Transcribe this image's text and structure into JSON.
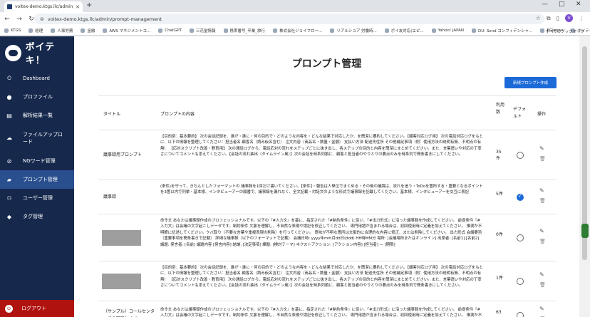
{
  "browser": {
    "tab_title": "voitex-demo.ktgs.llc/admin/pro",
    "url": "voitex-demo.ktgs.llc/admin/prompt-management",
    "bookmarks": [
      "KTGS",
      "経理",
      "人事労務",
      "金融",
      "AWS マネジメントコ...",
      "ChatGPT",
      "三花堂情報",
      "携帯番号_卒業_旅行",
      "株式会社ジョイフロー...",
      "リアルショア 労働時...",
      "ボイ友対応(エピ...",
      "Yahoo! JAPAN",
      "DU: Send コンフィデンシャ...",
      "EGJapan",
      "ボイテキ！"
    ],
    "all_bookmarks": "すべてのブックマーク",
    "avatar_letter": "V"
  },
  "sidebar": {
    "brand": "ボイテキ！",
    "items": [
      {
        "label": "Dashboard",
        "icon": "dashboard-icon"
      },
      {
        "label": "プロファイル",
        "icon": "person-icon"
      },
      {
        "label": "解析結果一覧",
        "icon": "list-icon"
      },
      {
        "label": "ファイルアップロード",
        "icon": "upload-icon"
      },
      {
        "label": "NGワード管理",
        "icon": "block-icon"
      },
      {
        "label": "プロンプト管理",
        "icon": "chat-icon"
      },
      {
        "label": "ユーザー管理",
        "icon": "group-icon"
      },
      {
        "label": "タグ管理",
        "icon": "tag-icon"
      }
    ],
    "logout": "ログアウト"
  },
  "main": {
    "title": "プロンプト管理",
    "new_button": "新規プロンプト作成",
    "headers": {
      "title": "タイトル",
      "content": "プロンプトの内容",
      "count": "利用数",
      "default": "デフォルト",
      "actions": "操作"
    },
    "rows": [
      {
        "title": "議事録用プロンプト",
        "content": "【目的別：基本要約】 次の会話記録を、誰が・誰に・何の目的で・どのような内容を・どんな結果で対応したか、を簡潔に要約してください。【顧客対応ログ用】 次の電話対応ログをもとに、以下の情報を整理してください：担当者名 顧客名（読み仮名含む） 注文内容（商品名・数量・金額） 支払い方法 配送先住所 その他補足事項（例：使用方法の説明有無、不明点の有無） 【応対スクリプト改善・教育用】 次の通話ログから、電話応対の流れをステップごとに抜き出し、各ステップの目的と内容を簡潔にまとめてください。また、言葉遣いや対応の丁寧さについてコメントも添えてください。【会話の流れ抽出（タイムライン風）】次の会話を時系列順に、顧客と担当者のやりとりの要点のみを時系列で簡条書きにしてください。",
        "count": "35件",
        "default": false
      },
      {
        "title": "議事録",
        "content": "(条件)を守って、きちんとしたフォーマットの 議事録を1回だけ書いてください。【条件】・報告は人単位でまとめる・その後の議論は、流れを追う・ToDoを箇所する・重要となるポイントを3箇以内で列挙・基本様、インタビューアーの順番で、議事録を漏れなく、全文記載・対話文のような形式で議事録を記載してください。基本様、インタビューアーを交互に表記",
        "count": "5件",
        "default": true
      },
      {
        "title": "",
        "content": "命令文 あなたは議事録作成のプロフェッショナルです。以下の『#入力文』を基に、指定された『#制約条件』に従い、『#出力形式』に沿った議事録を作成してください。 前提条件『#入力文』は会議の文字起こしデータです。制約条件 文脈を理解し、不自然な表現や誤記を修正してください。 専門用語が含まれる場合は、初回使用時に定義を加えてください。 推測か不明瞭に記述してください。ケバ取り（不要な言葉や重複表現の削除）を行ってください。 意味が不明な箇所は文脈的に合理的な内容に修正、または削除してください。 出力形式 会議要旨（重要事項を簡条書きで記載） 詳細な議事録（以下のフォーマットで記載） 会議日時: yyyy年mm月dd日(ddd) HH時MM分 場所: [会議場所またはオンライン] 出席者: [名前1] [名前2] 議題: 発言者: [名前] 議題内容 [発言内容] 結論: [決定事項] 課題: [検討テーマ] ネクストアクション: [アクション内容] [担当者] — [期限]",
        "count": "0件",
        "default": false
      },
      {
        "title": "",
        "content": "【目的別：基本要約】 次の会話記録を、誰が・誰に・何の目的で・どのような内容を・どんな結果で対応したか、を簡潔に要約してください。【顧客対応ログ用】 次の電話対応ログをもとに、以下の情報を整理してください：担当者名 顧客名（読み仮名含む） 注文内容（商品名・数量・金額） 支払い方法 配送先住所 その他補足事項（例：使用方法の説明有無、不明点の有無） 【応対スクリプト改善・教育用】 次の通話ログから、電話応対の流れをステップごとに抜き出し、各ステップの目的と内容を簡潔にまとめてください。また、言葉遣いや対応の丁寧さについてコメントも添えてください。【会話の流れ抽出（タイムライン風）】次の会話を時系列順に、顧客と担当者のやりとりの要点のみを時系列で簡条書きにしてください。",
        "count": "1件",
        "default": false
      },
      {
        "title": "（サンプル）コールセンターでの顧客とオペ",
        "content": "命令文 あなたは議事録作成のプロフェッショナルです。以下の『#入力文』を基に、指定された『#制約条件』に従い、『#出力形式』に沿った議事録を作成してください。 前提条件『#入力文』は会議の文字起こしデータです。制約条件 文脈を理解し、不自然な表現や誤記を修正してください。 専門用語が含まれる場合は、初回使用時に定義を加えてください。 推測か不明瞭に記述してください。ケバ取り（不要な言葉や重複表現の削除）を行ってください。 意味が不明な箇所は文脈的に合理的な",
        "count": "63",
        "default": false
      }
    ]
  }
}
